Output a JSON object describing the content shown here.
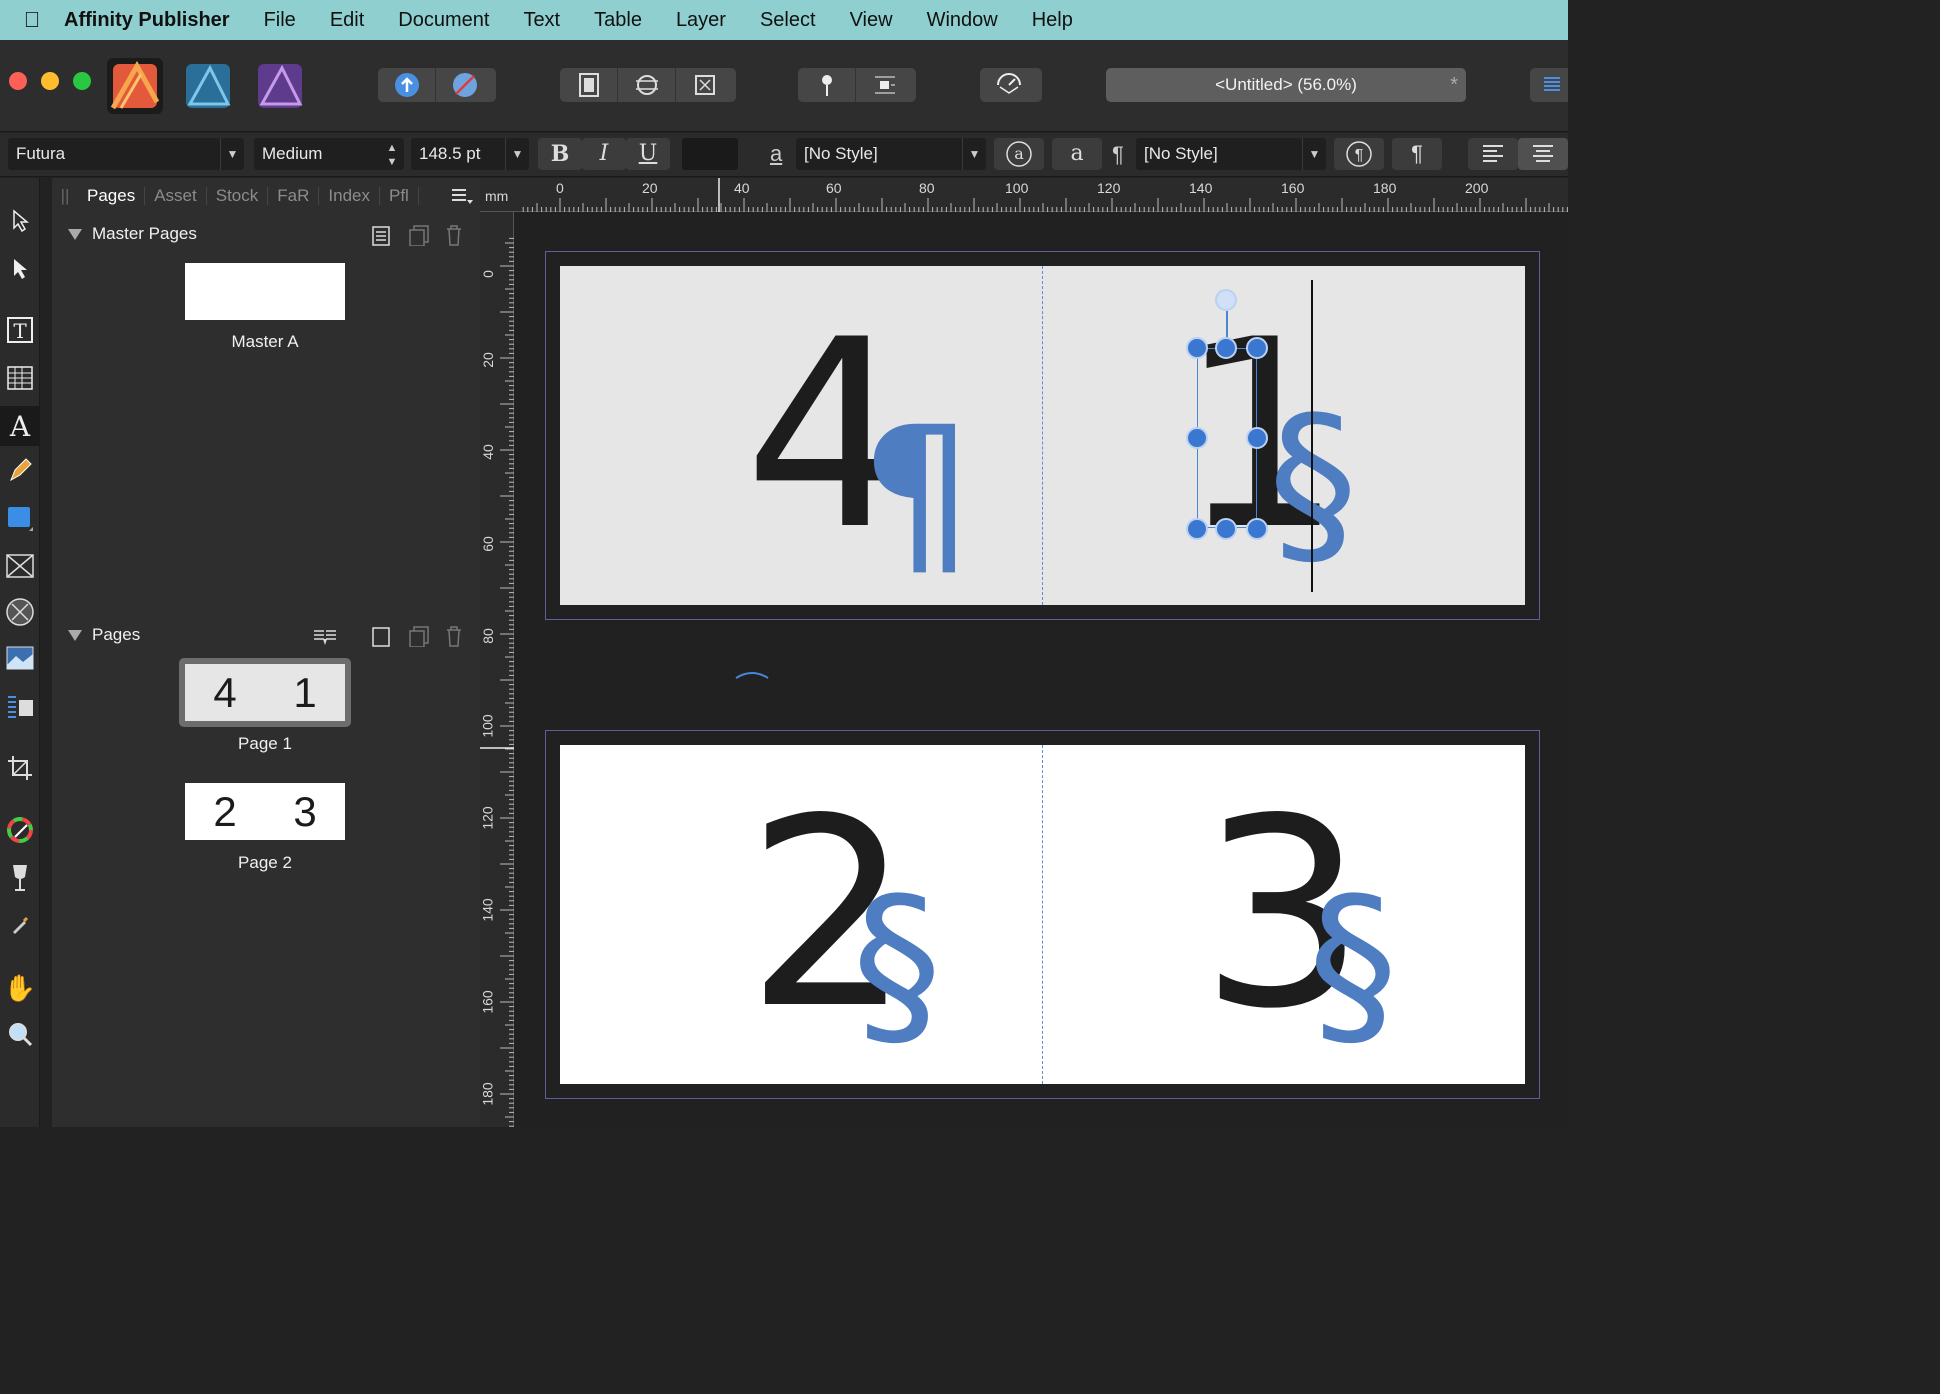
{
  "menubar": {
    "app_name": "Affinity Publisher",
    "items": [
      "File",
      "Edit",
      "Document",
      "Text",
      "Table",
      "Layer",
      "Select",
      "View",
      "Window",
      "Help"
    ]
  },
  "toolbar": {
    "doc_title": "<Untitled> (56.0%)",
    "modified_mark": "*"
  },
  "context_toolbar": {
    "font_family": "Futura",
    "font_weight": "Medium",
    "font_size": "148.5 pt",
    "bold": "B",
    "italic": "I",
    "underline": "U",
    "char_style_icon": "a",
    "char_style": "[No Style]",
    "para_symbol": "¶",
    "para_style": "[No Style]",
    "a_button": "a",
    "pilcrow_button": "¶"
  },
  "panel": {
    "tabs": [
      "Pages",
      "Asset",
      "Stock",
      "FaR",
      "Index",
      "Pfl"
    ],
    "master_pages_title": "Master Pages",
    "master_label": "Master A",
    "pages_title": "Pages",
    "page1": {
      "label": "Page 1",
      "left": "4",
      "right": "1"
    },
    "page2": {
      "label": "Page 2",
      "left": "2",
      "right": "3"
    }
  },
  "ruler": {
    "unit": "mm",
    "h_labels": [
      "0",
      "20",
      "40",
      "60",
      "80",
      "100",
      "120",
      "140",
      "160",
      "180",
      "200"
    ],
    "v_labels": [
      "0",
      "20",
      "40",
      "60",
      "80",
      "100",
      "120",
      "140",
      "160",
      "180"
    ]
  },
  "canvas": {
    "page_digits": [
      "4",
      "1",
      "2",
      "3"
    ],
    "pilcrow": "¶",
    "section": "§"
  }
}
